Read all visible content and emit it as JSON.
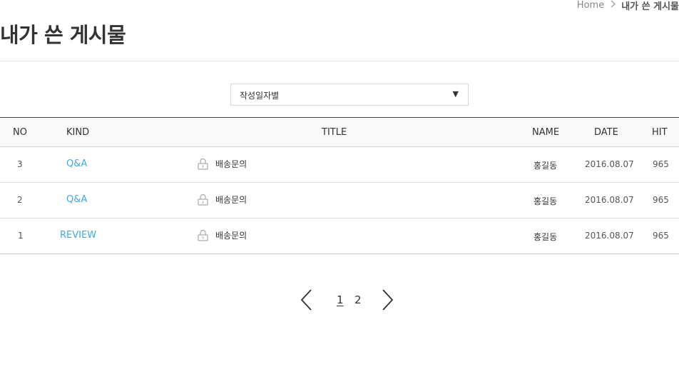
{
  "breadcrumb": {
    "home": "Home",
    "current": "내가 쓴 게시물"
  },
  "page": {
    "title": "내가 쓴 게시물"
  },
  "sort": {
    "selected": "작성일자별",
    "icon": "caret-down-icon"
  },
  "table": {
    "columns": [
      "NO",
      "KIND",
      "TITLE",
      "NAME",
      "DATE",
      "HIT"
    ],
    "rows": [
      {
        "no": "3",
        "kind": "Q&A",
        "title": "배송문의",
        "name": "홍길동",
        "date": "2016.08.07",
        "hit": "965",
        "locked": true
      },
      {
        "no": "2",
        "kind": "Q&A",
        "title": "배송문의",
        "name": "홍길동",
        "date": "2016.08.07",
        "hit": "965",
        "locked": true
      },
      {
        "no": "1",
        "kind": "REVIEW",
        "title": "배송문의",
        "name": "홍길동",
        "date": "2016.08.07",
        "hit": "965",
        "locked": true
      }
    ]
  },
  "pagination": {
    "pages": [
      "1",
      "2"
    ],
    "current": "1"
  },
  "colors": {
    "accent": "#3fa9df",
    "text": "#333333",
    "border": "#dcdcdc"
  }
}
